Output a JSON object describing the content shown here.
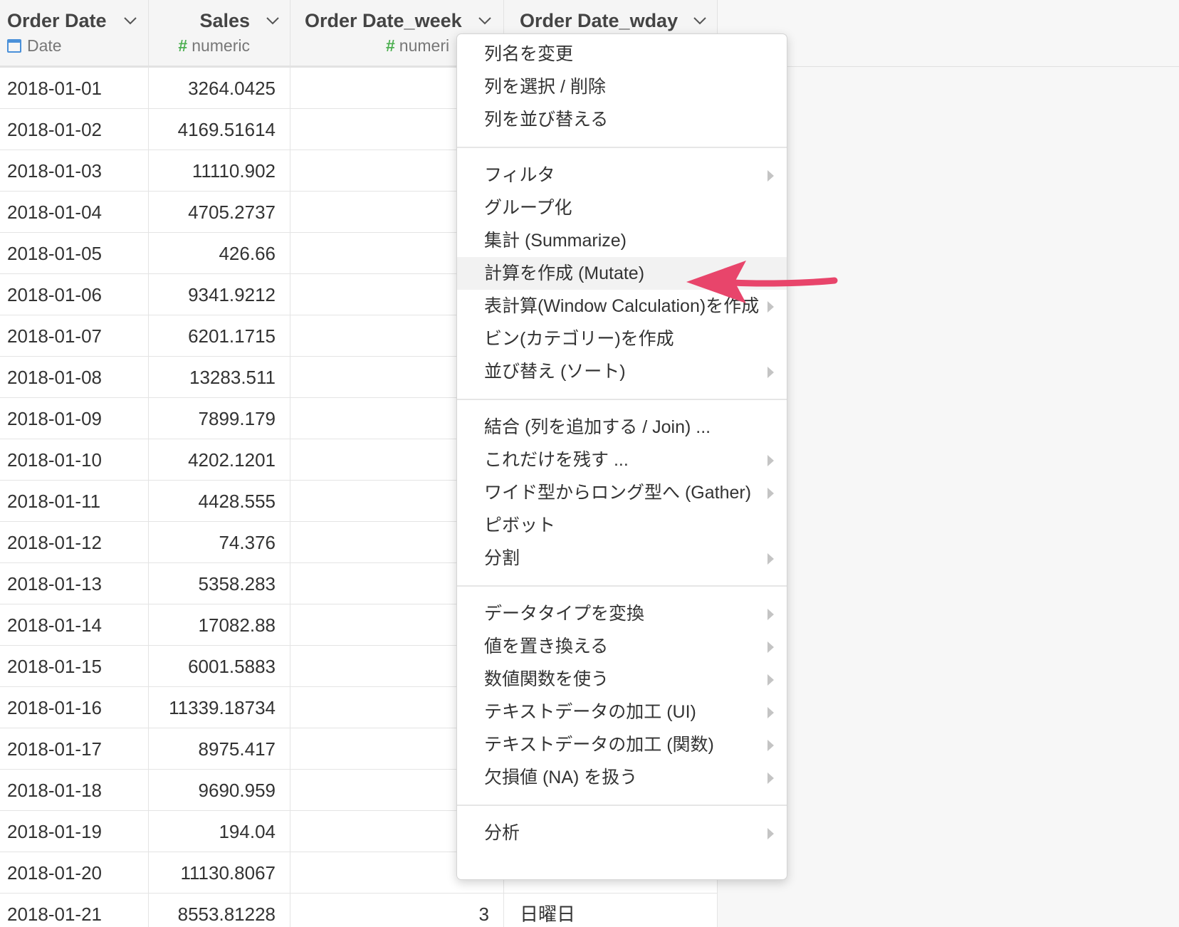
{
  "columns": [
    {
      "name": "Order Date",
      "type": "Date"
    },
    {
      "name": "Sales",
      "type": "numeric"
    },
    {
      "name": "Order Date_week",
      "type": "numeri"
    },
    {
      "name": "Order Date_wday",
      "type": ""
    }
  ],
  "rows": [
    [
      "2018-01-01",
      "3264.0425",
      "",
      ""
    ],
    [
      "2018-01-02",
      "4169.51614",
      "",
      ""
    ],
    [
      "2018-01-03",
      "11110.902",
      "",
      ""
    ],
    [
      "2018-01-04",
      "4705.2737",
      "",
      ""
    ],
    [
      "2018-01-05",
      "426.66",
      "",
      ""
    ],
    [
      "2018-01-06",
      "9341.9212",
      "",
      ""
    ],
    [
      "2018-01-07",
      "6201.1715",
      "",
      ""
    ],
    [
      "2018-01-08",
      "13283.511",
      "",
      ""
    ],
    [
      "2018-01-09",
      "7899.179",
      "",
      ""
    ],
    [
      "2018-01-10",
      "4202.1201",
      "",
      ""
    ],
    [
      "2018-01-11",
      "4428.555",
      "",
      ""
    ],
    [
      "2018-01-12",
      "74.376",
      "",
      ""
    ],
    [
      "2018-01-13",
      "5358.283",
      "",
      ""
    ],
    [
      "2018-01-14",
      "17082.88",
      "",
      ""
    ],
    [
      "2018-01-15",
      "6001.5883",
      "",
      ""
    ],
    [
      "2018-01-16",
      "11339.18734",
      "",
      ""
    ],
    [
      "2018-01-17",
      "8975.417",
      "",
      ""
    ],
    [
      "2018-01-18",
      "9690.959",
      "",
      ""
    ],
    [
      "2018-01-19",
      "194.04",
      "",
      ""
    ],
    [
      "2018-01-20",
      "11130.8067",
      "",
      ""
    ],
    [
      "2018-01-21",
      "8553.81228",
      "3",
      "日曜日"
    ]
  ],
  "menu": {
    "groups": [
      [
        {
          "label": "列名を変更",
          "submenu": false
        },
        {
          "label": "列を選択 / 削除",
          "submenu": false
        },
        {
          "label": "列を並び替える",
          "submenu": false
        }
      ],
      [
        {
          "label": "フィルタ",
          "submenu": true
        },
        {
          "label": "グループ化",
          "submenu": false
        },
        {
          "label": "集計 (Summarize)",
          "submenu": false
        },
        {
          "label": "計算を作成 (Mutate)",
          "submenu": false,
          "highlighted": true
        },
        {
          "label": "表計算(Window Calculation)を作成",
          "submenu": true
        },
        {
          "label": "ビン(カテゴリー)を作成",
          "submenu": false
        },
        {
          "label": "並び替え (ソート)",
          "submenu": true
        }
      ],
      [
        {
          "label": "結合 (列を追加する / Join) ...",
          "submenu": false
        },
        {
          "label": "これだけを残す ...",
          "submenu": true
        },
        {
          "label": "ワイド型からロング型へ (Gather)",
          "submenu": true
        },
        {
          "label": "ピボット",
          "submenu": false
        },
        {
          "label": "分割",
          "submenu": true
        }
      ],
      [
        {
          "label": "データタイプを変換",
          "submenu": true
        },
        {
          "label": "値を置き換える",
          "submenu": true
        },
        {
          "label": "数値関数を使う",
          "submenu": true
        },
        {
          "label": "テキストデータの加工 (UI)",
          "submenu": true
        },
        {
          "label": "テキストデータの加工 (関数)",
          "submenu": true
        },
        {
          "label": "欠損値 (NA) を扱う",
          "submenu": true
        }
      ],
      [
        {
          "label": "分析",
          "submenu": true
        }
      ]
    ]
  },
  "colors": {
    "arrow": "#e8456b",
    "numeric_hash": "#4caf50",
    "date_icon": "#4a90d9",
    "highlight": "#f2f2f2"
  }
}
